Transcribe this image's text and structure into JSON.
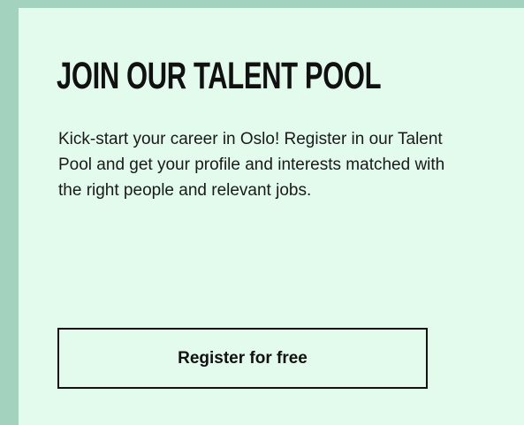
{
  "card": {
    "title": "JOIN OUR TALENT POOL",
    "description": "Kick-start your career in Oslo! Register in our Talent Pool and get your profile and interests matched with the right people and relevant jobs.",
    "cta_label": "Register for free"
  },
  "colors": {
    "page_background": "#a3d3bf",
    "card_background": "#e2fbec",
    "text": "#111111"
  }
}
